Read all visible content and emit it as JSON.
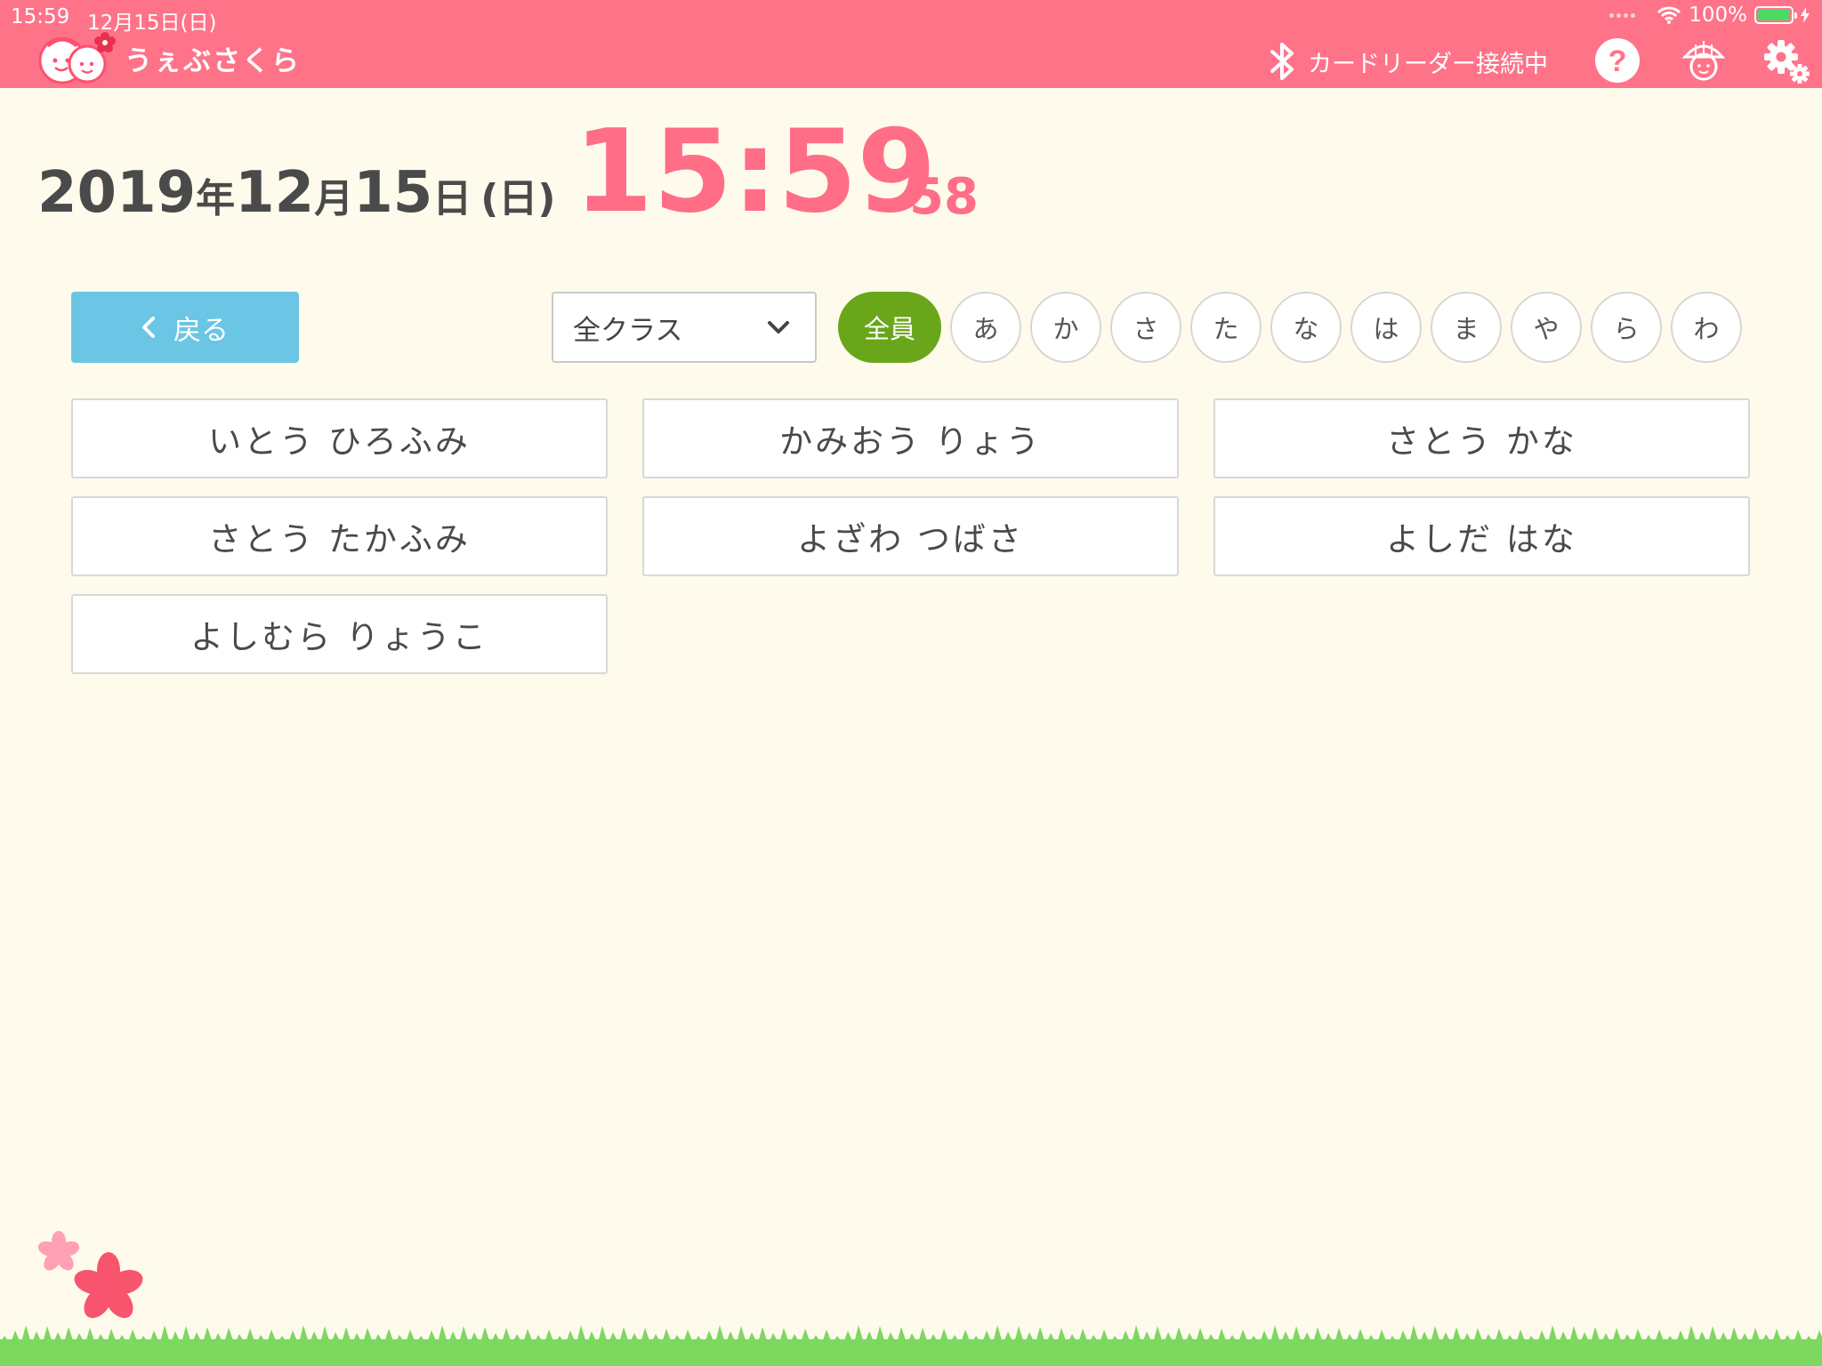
{
  "status_bar": {
    "time": "15:59",
    "date": "12月15日(日)",
    "battery": "100%",
    "battery_level": 1.0
  },
  "header": {
    "app_name": "うぇぶさくら",
    "card_reader_status": "カードリーダー接続中",
    "icons": [
      "bluetooth-icon",
      "help-icon",
      "child-profile-icon",
      "settings-icon"
    ]
  },
  "datetime": {
    "year": "2019",
    "year_unit": "年",
    "month": "12",
    "month_unit": "月",
    "day": "15",
    "day_unit": "日",
    "weekday": "(日)",
    "clock": "15:59",
    "seconds": "58"
  },
  "controls": {
    "back_label": "戻る",
    "class_select_value": "全クラス"
  },
  "kana_filters": [
    "全員",
    "あ",
    "か",
    "さ",
    "た",
    "な",
    "は",
    "ま",
    "や",
    "ら",
    "わ"
  ],
  "active_filter": "全員",
  "children": [
    "いとう ひろふみ",
    "かみおう りょう",
    "さとう かな",
    "さとう たかふみ",
    "よざわ つばさ",
    "よしだ はな",
    "よしむら りょうこ"
  ],
  "colors": {
    "header": "#ff7389",
    "clock": "#ff6d87",
    "back_button": "#6ac6e4",
    "active_filter": "#6aa61a",
    "background": "#fefbec",
    "grass": "#7cd85f"
  }
}
